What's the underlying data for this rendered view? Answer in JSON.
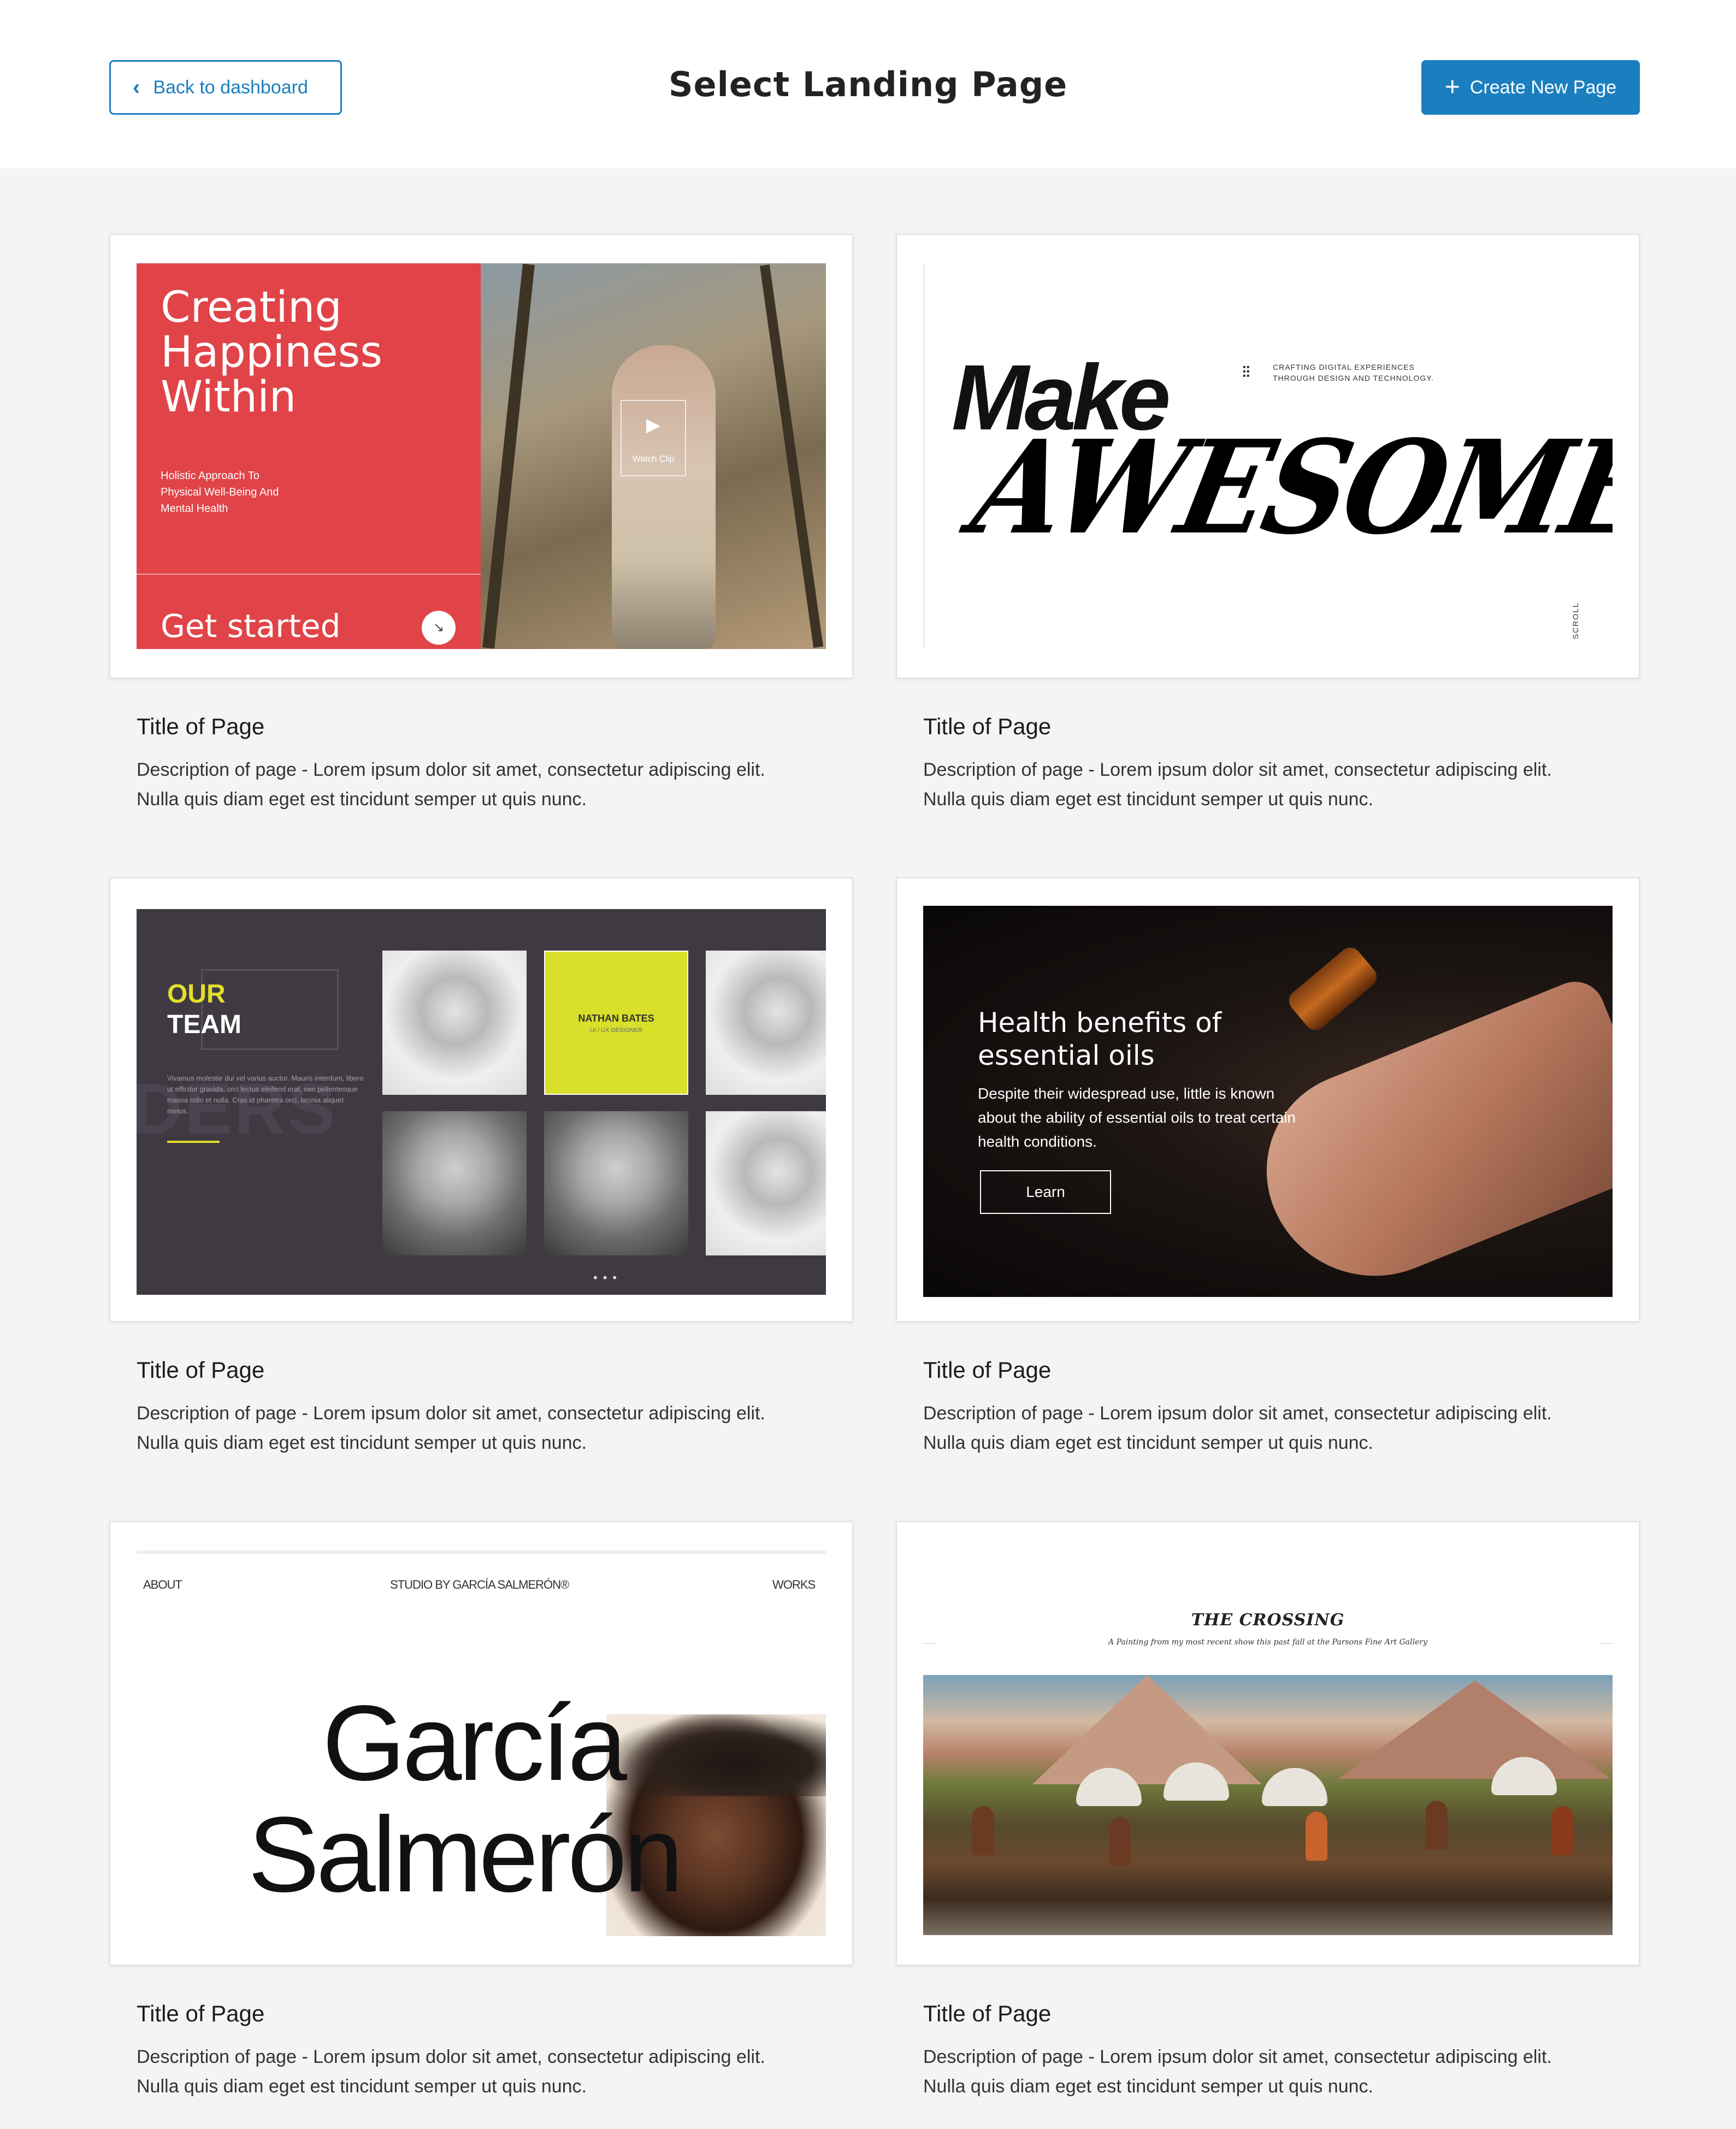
{
  "header": {
    "back_label": "Back to dashboard",
    "title": "Select Landing Page",
    "create_label": "Create New Page",
    "back_icon": "chevron-left-icon",
    "create_icon": "plus-icon",
    "accent_color": "#1b7fbf"
  },
  "cards": [
    {
      "title": "Title of Page",
      "description": "Description of page - Lorem ipsum dolor sit amet, consectetur adipiscing elit. Nulla quis diam eget est tincidunt semper ut quis nunc.",
      "preview": {
        "headline": "Creating Happiness Within",
        "subtext": "Holistic Approach To Physical Well-Being And Mental Health",
        "cta": "Get started",
        "video_label": "Watch Clip"
      }
    },
    {
      "title": "Title of Page",
      "description": "Description of page - Lorem ipsum dolor sit amet, consectetur adipiscing elit. Nulla quis diam eget est tincidunt semper ut quis nunc.",
      "preview": {
        "word1": "Make",
        "word2": "AWESOME",
        "tagline": "CRAFTING DIGITAL EXPERIENCES THROUGH DESIGN AND TECHNOLOGY.",
        "scroll": "SCROLL"
      }
    },
    {
      "title": "Title of Page",
      "description": "Description of page - Lorem ipsum dolor sit amet, consectetur adipiscing elit. Nulla quis diam eget est tincidunt semper ut quis nunc.",
      "preview": {
        "heading1": "OUR",
        "heading2": "TEAM",
        "member_name": "NATHAN BATES",
        "member_role": "UI / UX DESIGNER",
        "body": "Vivamus molestie dui vel varius auctor. Mauris interdum, libero ut efficitur gravida, orci lectus eleifend erat, nec pellentesque massa odio et nulla. Cras id pharetra orci, lacinia aliquet metus.",
        "ghost_text": "DERS"
      }
    },
    {
      "title": "Title of Page",
      "description": "Description of page - Lorem ipsum dolor sit amet, consectetur adipiscing elit. Nulla quis diam eget est tincidunt semper ut quis nunc.",
      "preview": {
        "headline": "Health benefits of essential oils",
        "body": "Despite their widespread use, little is known about the ability of essential oils to treat certain health conditions.",
        "button": "Learn"
      }
    },
    {
      "title": "Title of Page",
      "description": "Description of page - Lorem ipsum dolor sit amet, consectetur adipiscing elit. Nulla quis diam eget est tincidunt semper ut quis nunc.",
      "preview": {
        "nav_left": "ABOUT",
        "nav_center": "STUDIO BY GARCÍA SALMERÓN®",
        "nav_right": "WORKS",
        "name1": "García",
        "name2": "Salmerón"
      }
    },
    {
      "title": "Title of Page",
      "description": "Description of page - Lorem ipsum dolor sit amet, consectetur adipiscing elit. Nulla quis diam eget est tincidunt semper ut quis nunc.",
      "preview": {
        "title": "THE CROSSING",
        "subtitle": "A Painting from my most recent show this past fall at the Parsons Fine Art Gallery"
      }
    }
  ]
}
